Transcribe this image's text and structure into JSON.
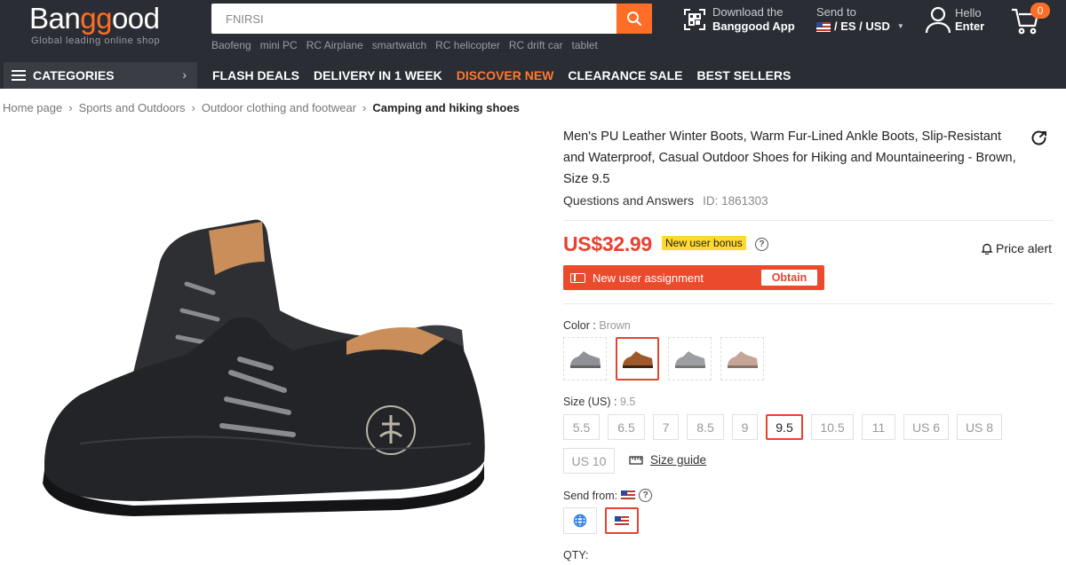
{
  "header": {
    "logo_text_pre": "Ban",
    "logo_text_accent": "gg",
    "logo_text_post": "ood",
    "tagline": "Global leading online shop",
    "search_value": "FNIRSI",
    "hot_words": [
      "Baofeng",
      "mini PC",
      "RC Airplane",
      "smartwatch",
      "RC helicopter",
      "RC drift car",
      "tablet"
    ],
    "app_line1": "Download the",
    "app_line2": "Banggood App",
    "send_to_label": "Send to",
    "send_to_value": "/ ES / USD",
    "user_line1": "Hello",
    "user_line2": "Enter",
    "cart_count": "0"
  },
  "nav": {
    "categories_label": "CATEGORIES",
    "links": [
      "FLASH DEALS",
      "DELIVERY IN 1 WEEK",
      "DISCOVER NEW",
      "CLEARANCE SALE",
      "BEST SELLERS"
    ]
  },
  "breadcrumb": [
    "Home page",
    "Sports and Outdoors",
    "Outdoor clothing and footwear",
    "Camping and hiking shoes"
  ],
  "product": {
    "title": "Men's PU Leather Winter Boots, Warm Fur-Lined Ankle Boots, Slip-Resistant and Waterproof, Casual Outdoor Shoes for Hiking and Mountaineering - Brown, Size 9.5",
    "qa_label": "Questions and Answers",
    "id_label": "ID: 1861303",
    "price": "US$32.99",
    "bonus_badge": "New user bonus",
    "price_alert": "Price alert",
    "assignment_text": "New user assignment",
    "obtain_label": "Obtain",
    "color_label": "Color :",
    "color_value": "Brown",
    "size_label": "Size (US) :",
    "size_value": "9.5",
    "sizes": [
      "5.5",
      "6.5",
      "7",
      "8.5",
      "9",
      "9.5",
      "10.5",
      "11",
      "US 6",
      "US 8",
      "US 10"
    ],
    "size_guide": "Size guide",
    "send_from_label": "Send from:",
    "qty_label": "QTY:"
  },
  "colors": {
    "accent": "#ff6e26",
    "price_red": "#e8422f",
    "header_bg": "#2b2d35"
  }
}
